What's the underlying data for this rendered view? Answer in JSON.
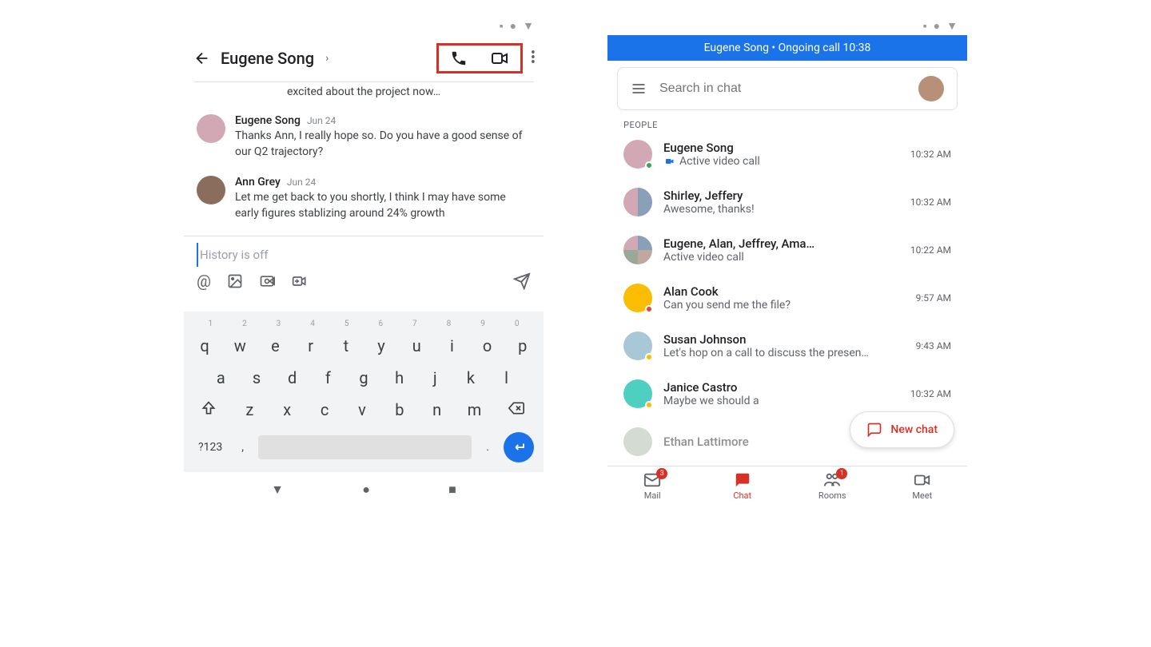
{
  "left": {
    "header": {
      "contact": "Eugene Song",
      "chevron": "›"
    },
    "truncated": "excited about the project now…",
    "messages": [
      {
        "sender": "Eugene Song",
        "time": "Jun 24",
        "text": "Thanks Ann, I really hope so. Do you have a good sense of our Q2 trajectory?"
      },
      {
        "sender": "Ann Grey",
        "time": "Jun 24",
        "text": "Let me get back to you shortly, I think I may have some early figures stablizing around 24% growth"
      }
    ],
    "history_placeholder": "History is off",
    "keyboard": {
      "nums": [
        "1",
        "2",
        "3",
        "4",
        "5",
        "6",
        "7",
        "8",
        "9",
        "0"
      ],
      "row1": [
        "q",
        "w",
        "e",
        "r",
        "t",
        "y",
        "u",
        "i",
        "o",
        "p"
      ],
      "row2": [
        "a",
        "s",
        "d",
        "f",
        "g",
        "h",
        "j",
        "k",
        "l"
      ],
      "row3": [
        "z",
        "x",
        "c",
        "v",
        "b",
        "n",
        "m"
      ],
      "sym": "?123",
      "comma": ",",
      "period": "."
    }
  },
  "right": {
    "banner": "Eugene Song • Ongoing call 10:38",
    "search_placeholder": "Search in chat",
    "section": "PEOPLE",
    "people": [
      {
        "name": "Eugene Song",
        "sub": "Active video call",
        "time": "10:32 AM",
        "video": true
      },
      {
        "name": "Shirley, Jeffery",
        "sub": "Awesome, thanks!",
        "time": "10:32 AM"
      },
      {
        "name": "Eugene, Alan, Jeffrey, Ama…",
        "sub": "Active video call",
        "time": "10:22 AM"
      },
      {
        "name": "Alan Cook",
        "sub": "Can you send me the file?",
        "time": "9:57 AM"
      },
      {
        "name": "Susan Johnson",
        "sub": "Let's hop on a call to discuss the presen…",
        "time": "9:43 AM"
      },
      {
        "name": "Janice Castro",
        "sub": "Maybe we should a",
        "time": "10:32 AM"
      },
      {
        "name": "Ethan Lattimore",
        "sub": "",
        "time": ""
      }
    ],
    "fab": "New chat",
    "tabs": {
      "mail": "Mail",
      "mail_badge": "3",
      "chat": "Chat",
      "rooms": "Rooms",
      "rooms_badge": "1",
      "meet": "Meet"
    }
  }
}
